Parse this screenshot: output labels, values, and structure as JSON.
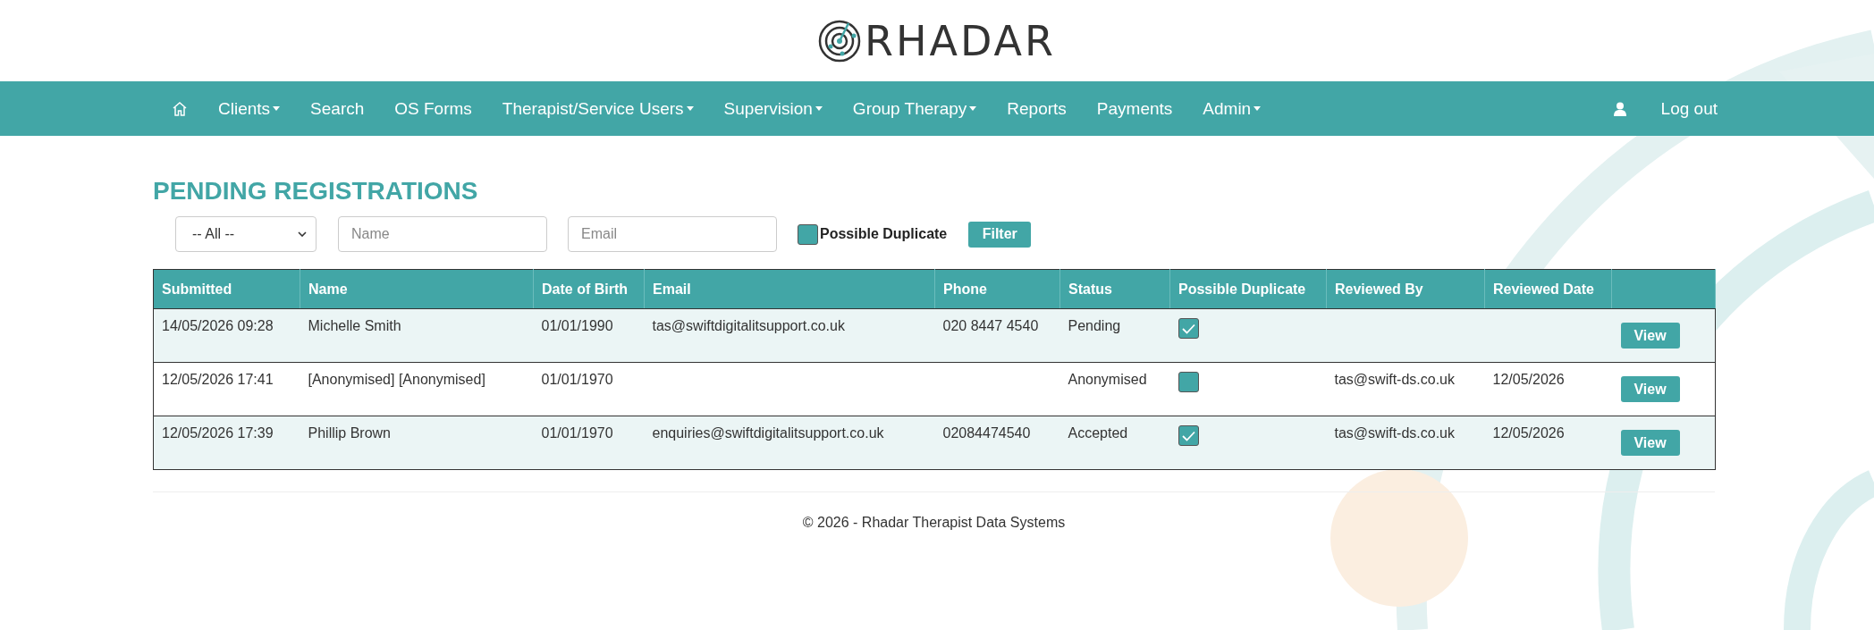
{
  "logo": {
    "text": "RHADAR"
  },
  "nav": {
    "items": [
      {
        "label": "Clients",
        "dropdown": true
      },
      {
        "label": "Search",
        "dropdown": false
      },
      {
        "label": "OS Forms",
        "dropdown": false
      },
      {
        "label": "Therapist/Service Users",
        "dropdown": true
      },
      {
        "label": "Supervision",
        "dropdown": true
      },
      {
        "label": "Group Therapy",
        "dropdown": true
      },
      {
        "label": "Reports",
        "dropdown": false
      },
      {
        "label": "Payments",
        "dropdown": false
      },
      {
        "label": "Admin",
        "dropdown": true
      }
    ],
    "logout": "Log out"
  },
  "page_title": "PENDING REGISTRATIONS",
  "filters": {
    "status_select": "-- All --",
    "name_placeholder": "Name",
    "email_placeholder": "Email",
    "duplicate_checkbox": {
      "label": "Possible Duplicate",
      "checked": false
    },
    "button": "Filter"
  },
  "table": {
    "columns": [
      "Submitted",
      "Name",
      "Date of Birth",
      "Email",
      "Phone",
      "Status",
      "Possible Duplicate",
      "Reviewed By",
      "Reviewed Date"
    ],
    "rows": [
      {
        "submitted": "14/05/2026 09:28",
        "name": "Michelle Smith",
        "dob": "01/01/1990",
        "email": "tas@swiftdigitalitsupport.co.uk",
        "phone": "020 8447 4540",
        "status": "Pending",
        "possible_duplicate": true,
        "reviewed_by": "",
        "reviewed_date": "",
        "action": "View"
      },
      {
        "submitted": "12/05/2026 17:41",
        "name": "[Anonymised] [Anonymised]",
        "dob": "01/01/1970",
        "email": "",
        "phone": "",
        "status": "Anonymised",
        "possible_duplicate": false,
        "reviewed_by": "tas@swift-ds.co.uk",
        "reviewed_date": "12/05/2026",
        "action": "View"
      },
      {
        "submitted": "12/05/2026 17:39",
        "name": "Phillip Brown",
        "dob": "01/01/1970",
        "email": "enquiries@swiftdigitalitsupport.co.uk",
        "phone": "02084474540",
        "status": "Accepted",
        "possible_duplicate": true,
        "reviewed_by": "tas@swift-ds.co.uk",
        "reviewed_date": "12/05/2026",
        "action": "View"
      }
    ]
  },
  "footer": "© 2026 - Rhadar Therapist Data Systems"
}
